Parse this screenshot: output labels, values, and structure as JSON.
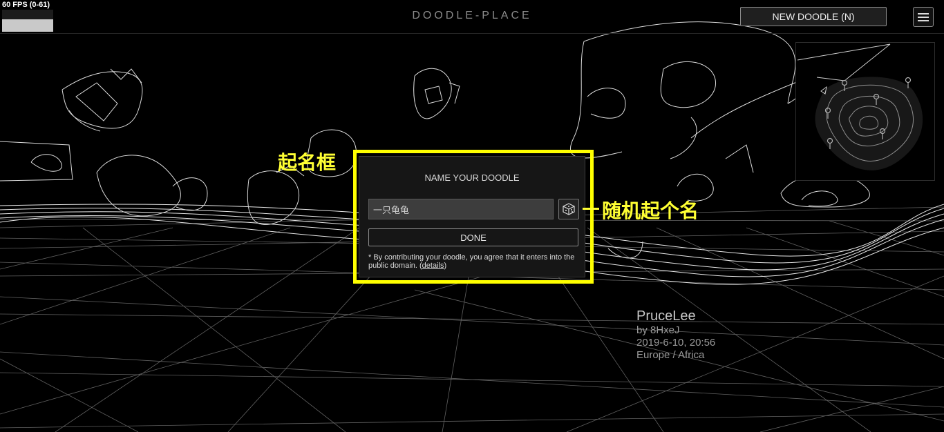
{
  "fps": {
    "label": "60 FPS (0-61)"
  },
  "header": {
    "title": "DOODLE-PLACE",
    "new_doodle_label": "NEW DOODLE (N)",
    "menu_icon": "hamburger-icon"
  },
  "dialog": {
    "title": "NAME YOUR DOODLE",
    "name_value": "一只龟龟",
    "random_icon": "dice-icon",
    "done_label": "DONE",
    "legal_text": "* By contributing your doodle, you agree that it enters into the public domain. (",
    "legal_link": "details",
    "legal_end": ")"
  },
  "annotations": {
    "name_box": "起名框",
    "random_name": "随机起个名",
    "color": "#ffff00"
  },
  "doodle_info": {
    "name": "PruceLee",
    "author": "by 8HxeJ",
    "timestamp": "2019-6-10, 20:56",
    "region": "Europe / Africa"
  }
}
